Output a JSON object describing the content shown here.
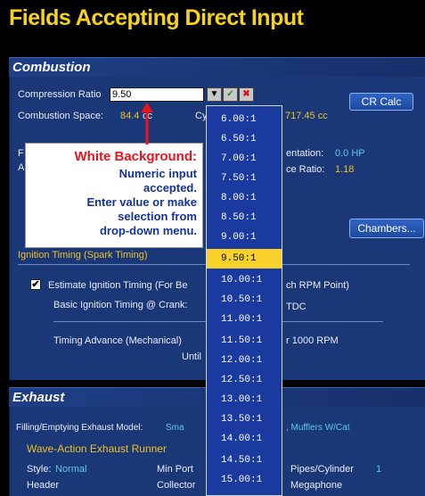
{
  "title": "Fields Accepting Direct Input",
  "combustion": {
    "section_label": "Combustion",
    "compression_ratio_label": "Compression Ratio",
    "compression_ratio_value": "9.50",
    "combustion_space_label": "Combustion Space:",
    "combustion_space_value": "84.4",
    "cc_unit": "cc",
    "cyl_label": "Cy",
    "cyl_value": "717.45 cc",
    "cr_calc_button": "CR Calc",
    "entation_label": "entation:",
    "entation_value": "0.0 HP",
    "ce_ratio_label": "ce Ratio:",
    "ce_ratio_value": "1.18",
    "chambers_button": "Chambers...",
    "ignition_timing_label": "Ignition Timing (Spark Timing)",
    "estimate_label": "Estimate Ignition Timing (For Be",
    "estimate_suffix": "ch RPM Point)",
    "basic_timing_label": "Basic Ignition Timing @ Crank:",
    "basic_timing_suffix": "TDC",
    "timing_advance_label": "Timing Advance (Mechanical)",
    "timing_advance_suffix": "r 1000 RPM",
    "until_label": "Until"
  },
  "callout": {
    "heading": "White Background:",
    "lines": [
      "Numeric input",
      "accepted.",
      "Enter value or make",
      "selection from",
      "drop-down menu."
    ]
  },
  "dropdown_options": [
    "6.00:1",
    "6.50:1",
    "7.00:1",
    "7.50:1",
    "8.00:1",
    "8.50:1",
    "9.00:1",
    "9.50:1",
    "10.00:1",
    "10.50:1",
    "11.00:1",
    "11.50:1",
    "12.00:1",
    "12.50:1",
    "13.00:1",
    "13.50:1",
    "14.00:1",
    "14.50:1",
    "15.00:1"
  ],
  "selected_option": "9.50:1",
  "exhaust": {
    "section_label": "Exhaust",
    "model_label": "Filling/Emptying Exhaust Model:",
    "model_value": "Sma",
    "model_suffix": ", Mufflers W/Cat",
    "wave_action_label": "Wave-Action Exhaust Runner",
    "style_label": "Style:",
    "style_value": "Normal",
    "min_port_label": "Min Port",
    "pipes_label": "Pipes/Cylinder",
    "pipes_value": "1",
    "header_label": "Header",
    "collector_label": "Collector",
    "megaphone_label": "Megaphone"
  },
  "colors": {
    "accent_yellow": "#f7d31a",
    "panel_blue": "#1a3778",
    "alert_red": "#e8141c"
  }
}
